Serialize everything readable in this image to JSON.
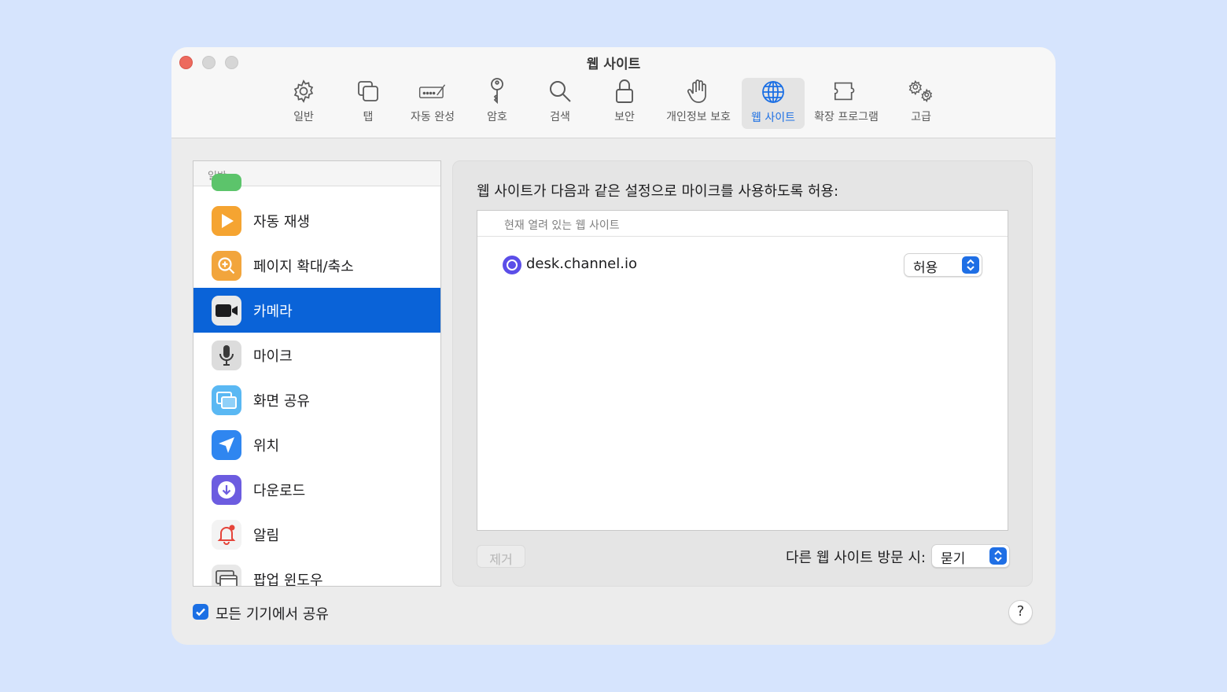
{
  "window": {
    "title": "웹 사이트"
  },
  "toolbar": {
    "items": [
      {
        "label": "일반",
        "icon": "gear-icon"
      },
      {
        "label": "탭",
        "icon": "tabs-icon"
      },
      {
        "label": "자동 완성",
        "icon": "autofill-icon"
      },
      {
        "label": "암호",
        "icon": "key-icon"
      },
      {
        "label": "검색",
        "icon": "search-icon"
      },
      {
        "label": "보안",
        "icon": "lock-icon"
      },
      {
        "label": "개인정보 보호",
        "icon": "hand-icon"
      },
      {
        "label": "웹 사이트",
        "icon": "globe-icon",
        "active": true
      },
      {
        "label": "확장 프로그램",
        "icon": "puzzle-icon"
      },
      {
        "label": "고급",
        "icon": "gears-icon"
      }
    ],
    "active_color": "#1b6fe4"
  },
  "sidebar": {
    "header": "일반",
    "items": [
      {
        "label": "자동 재생",
        "icon": "autoplay-icon"
      },
      {
        "label": "페이지 확대/축소",
        "icon": "zoom-icon"
      },
      {
        "label": "카메라",
        "icon": "camera-icon",
        "selected": true
      },
      {
        "label": "마이크",
        "icon": "microphone-icon"
      },
      {
        "label": "화면 공유",
        "icon": "screen-share-icon"
      },
      {
        "label": "위치",
        "icon": "location-icon"
      },
      {
        "label": "다운로드",
        "icon": "download-icon"
      },
      {
        "label": "알림",
        "icon": "bell-icon"
      },
      {
        "label": "팝업 윈도우",
        "icon": "popup-window-icon"
      }
    ],
    "selected_color": "#0a63d8"
  },
  "main": {
    "heading": "웹 사이트가 다음과 같은 설정으로 마이크를 사용하도록 허용:",
    "table": {
      "header": "현재 열려 있는 웹 사이트",
      "rows": [
        {
          "site": "desk.channel.io",
          "permission": "허용"
        }
      ]
    },
    "remove_button": "제거",
    "other_sites_label": "다른 웹 사이트 방문 시:",
    "other_sites_value": "묻기"
  },
  "footer": {
    "share_label": "모든 기기에서 공유",
    "share_checked": true,
    "help_label": "?"
  }
}
